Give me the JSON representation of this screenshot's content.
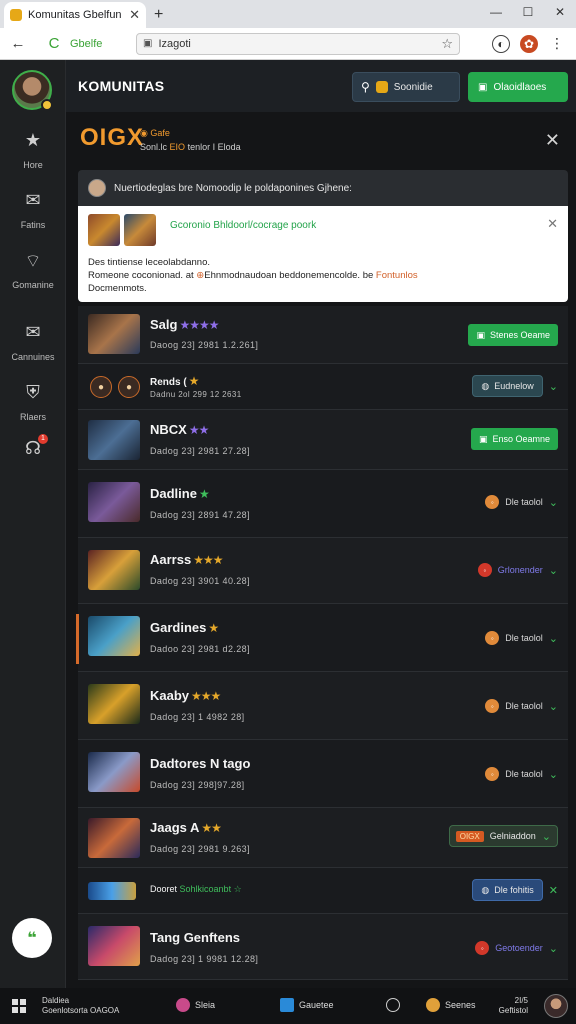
{
  "browser": {
    "tab_title": "Komunitas Gbelfun",
    "tab_close": "✕",
    "new_tab": "+",
    "window_controls": [
      "—",
      "☐",
      "✕"
    ],
    "back": "←",
    "reload": "C",
    "bookmark_label": "Gbelfe",
    "address": "Izagoti"
  },
  "sidebar": {
    "items": [
      {
        "label": "Hore",
        "icon": "star-icon",
        "glyph": "★"
      },
      {
        "label": "Fatins",
        "icon": "mail-icon",
        "glyph": "✉"
      },
      {
        "label": "Gomanine",
        "icon": "wifi-icon",
        "glyph": "⌔"
      },
      {
        "label": "Cannuines",
        "icon": "envelope-icon",
        "glyph": "✉"
      },
      {
        "label": "Rlaers",
        "icon": "shield-icon",
        "glyph": "⛨"
      }
    ],
    "notif_count": "1",
    "fab_glyph": "❝"
  },
  "header": {
    "title": "KOMUNITAS",
    "search_label": "Soonidie",
    "cta_label": "Olaoidlaoes"
  },
  "panel": {
    "logo": "OIGX",
    "logo_sub_1": "Gafe",
    "logo_sub_2a": "Sonl.lc",
    "logo_sub_2b": "EIO",
    "logo_sub_2c": "tenlor  I Eloda",
    "notice_text": "Nuertiodeglas bre Nomoodip le poldaponines Gjhene:",
    "popup_title": "Gcoronio Bhldoorl/cocrage poork",
    "popup_line1": "Des tintiense leceolabdanno.",
    "popup_line2a": "Romeone coconionad. at",
    "popup_line2b": "Ehnmodnaudoan beddonemencolde. be",
    "popup_line2c": "Fontunlos",
    "popup_line3": "Docmenmots."
  },
  "rows": [
    {
      "name": "Salg",
      "stars": "★★★★",
      "star_color": "purple",
      "meta": "Daoog 23] 2981 1.2.261]",
      "action": "green",
      "action_label": "Stenes Oeame"
    },
    {
      "name": "Rends (",
      "stars": "★",
      "star_color": "gold",
      "meta": "Dadnu 2ol 299 12 2631",
      "action": "pill",
      "action_label": "Eudnelow",
      "small": true
    },
    {
      "name": "NBCX",
      "stars": "★★",
      "star_color": "purple",
      "meta": "Dadog 23] 2981 27.28]",
      "action": "green",
      "action_label": "Enso Oeamne"
    },
    {
      "name": "Dadline",
      "stars": "★",
      "star_color": "green",
      "meta": "Dadog 23] 2891 47.28]",
      "action": "plain",
      "action_label": "Dle taolol"
    },
    {
      "name": "Aarrss",
      "stars": "★★★",
      "star_color": "gold",
      "meta": "Dadog 23] 3901 40.28]",
      "action": "blue",
      "action_label": "Grlonender"
    },
    {
      "name": "Gardines",
      "stars": "★",
      "star_color": "gold",
      "meta": "Dadoo 23] 2981 d2.28]",
      "action": "plain",
      "action_label": "Dle taolol"
    },
    {
      "name": "Kaaby",
      "stars": "★★★",
      "star_color": "gold",
      "meta": "Dadog 23] 1 4982 28]",
      "action": "plain",
      "action_label": "Dle taolol"
    },
    {
      "name": "Dadtores N tago",
      "stars": "",
      "star_color": "gold",
      "meta": "Dadog 23] 298]97.28]",
      "action": "plain",
      "action_label": "Dle taolol"
    },
    {
      "name": "Jaags A",
      "stars": "★★",
      "star_color": "gold",
      "meta": "Dadog 23] 2981 9.263]",
      "action": "orangepill",
      "action_label": "Gelniaddon",
      "tag_label": "OIGX"
    },
    {
      "name": "Dooret",
      "stars": "",
      "star_color": "green",
      "meta": "",
      "action": "bluepill",
      "action_label": "Dle fohitis",
      "small": true,
      "green_text": "Sohlkicoanbt",
      "green_star": "☆"
    },
    {
      "name": "Tang Genftens",
      "stars": "",
      "star_color": "gold",
      "meta": "Dadog 23] 1 9981 12.28]",
      "action": "blue",
      "action_label": "Geotoender"
    }
  ],
  "taskbar": {
    "search_line1": "Daldiea",
    "search_line2": "Goenlotsorta OAGOA",
    "item1": "Sleia",
    "item2": "Gauetee",
    "item3": "Seenes",
    "clock_line1": "2I/5",
    "clock_line2": "Geftistol"
  }
}
